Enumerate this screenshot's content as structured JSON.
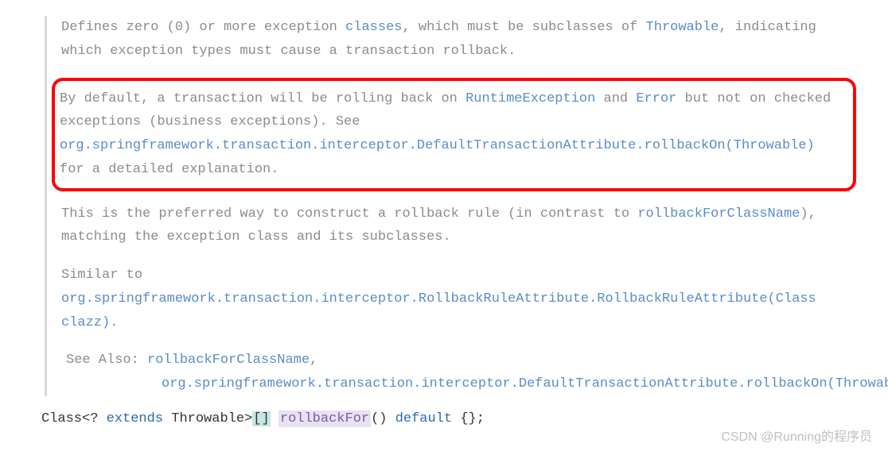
{
  "doc": {
    "para1": {
      "t1": "Defines zero (0) or more exception ",
      "l1": "classes",
      "t2": ", which must be subclasses of ",
      "l2": "Throwable",
      "t3": ", indicating which exception types must cause a transaction rollback."
    },
    "para2": {
      "t1": "By default, a transaction will be rolling back on ",
      "l1": "RuntimeException",
      "t2": " and ",
      "l2": "Error",
      "t3": " but not on checked exceptions (business exceptions). See ",
      "l3": "org.springframework.transaction.interceptor.DefaultTransactionAttribute.rollbackOn(Throwable)",
      "t4": " for a detailed explanation."
    },
    "para3": {
      "t1": "This is the preferred way to construct a rollback rule (in contrast to ",
      "l1": "rollbackForClassName",
      "t2": "), matching the exception class and its subclasses."
    },
    "para4": {
      "t1": "Similar to ",
      "l1": "org.springframework.transaction.interceptor.RollbackRuleAttribute.RollbackRuleAttribute(Class clazz)",
      "t2": "."
    },
    "seeAlso": {
      "label": "See Also: ",
      "l1": "rollbackForClassName",
      "sep": ",",
      "l2": "org.springframework.transaction.interceptor.DefaultTransactionAttribute.rollbackOn(Throwable)"
    }
  },
  "code": {
    "t1": "Class<? ",
    "kw1": "extends",
    "t2": " Throwable>",
    "bracket": "[]",
    "space": " ",
    "method": "rollbackFor",
    "t3": "() ",
    "kw2": "default",
    "t4": " {};"
  },
  "watermark": "CSDN @Running的程序员"
}
